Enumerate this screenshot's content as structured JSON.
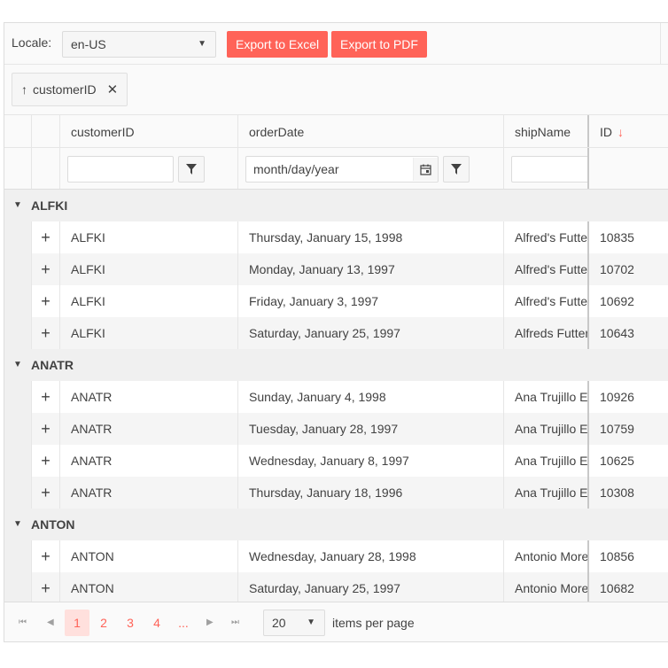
{
  "toolbar": {
    "locale_label": "Locale:",
    "locale_value": "en-US",
    "export_excel": "Export to Excel",
    "export_pdf": "Export to PDF"
  },
  "group_panel": {
    "chip_label": "customerID",
    "sort_icon": "sort-asc-icon",
    "close_icon": "close-icon"
  },
  "columns": {
    "customerID": "customerID",
    "orderDate": "orderDate",
    "shipName": "shipName",
    "id": "ID"
  },
  "filters": {
    "customerID_value": "",
    "orderDate_placeholder": "month/day/year",
    "shipName_value": ""
  },
  "groups": [
    {
      "key": "ALFKI",
      "rows": [
        {
          "customerID": "ALFKI",
          "orderDate": "Thursday, January 15, 1998",
          "shipName": "Alfred's Futterkiste",
          "id": "10835"
        },
        {
          "customerID": "ALFKI",
          "orderDate": "Monday, January 13, 1997",
          "shipName": "Alfred's Futterkiste",
          "id": "10702"
        },
        {
          "customerID": "ALFKI",
          "orderDate": "Friday, January 3, 1997",
          "shipName": "Alfred's Futterkiste",
          "id": "10692"
        },
        {
          "customerID": "ALFKI",
          "orderDate": "Saturday, January 25, 1997",
          "shipName": "Alfreds Futterkiste",
          "id": "10643"
        }
      ]
    },
    {
      "key": "ANATR",
      "rows": [
        {
          "customerID": "ANATR",
          "orderDate": "Sunday, January 4, 1998",
          "shipName": "Ana Trujillo Emparedados",
          "id": "10926"
        },
        {
          "customerID": "ANATR",
          "orderDate": "Tuesday, January 28, 1997",
          "shipName": "Ana Trujillo Emparedados",
          "id": "10759"
        },
        {
          "customerID": "ANATR",
          "orderDate": "Wednesday, January 8, 1997",
          "shipName": "Ana Trujillo Emparedados",
          "id": "10625"
        },
        {
          "customerID": "ANATR",
          "orderDate": "Thursday, January 18, 1996",
          "shipName": "Ana Trujillo Emparedados",
          "id": "10308"
        }
      ]
    },
    {
      "key": "ANTON",
      "rows": [
        {
          "customerID": "ANTON",
          "orderDate": "Wednesday, January 28, 1998",
          "shipName": "Antonio Moreno Taquería",
          "id": "10856"
        },
        {
          "customerID": "ANTON",
          "orderDate": "Saturday, January 25, 1997",
          "shipName": "Antonio Moreno Taquería",
          "id": "10682"
        }
      ]
    }
  ],
  "pager": {
    "pages": [
      "1",
      "2",
      "3",
      "4",
      "..."
    ],
    "current_page": "1",
    "page_size": "20",
    "items_per_page_label": "items per page"
  },
  "colors": {
    "accent": "#ff6358",
    "group_bg": "#f0f0f0",
    "alt_row_bg": "#f5f5f5"
  }
}
